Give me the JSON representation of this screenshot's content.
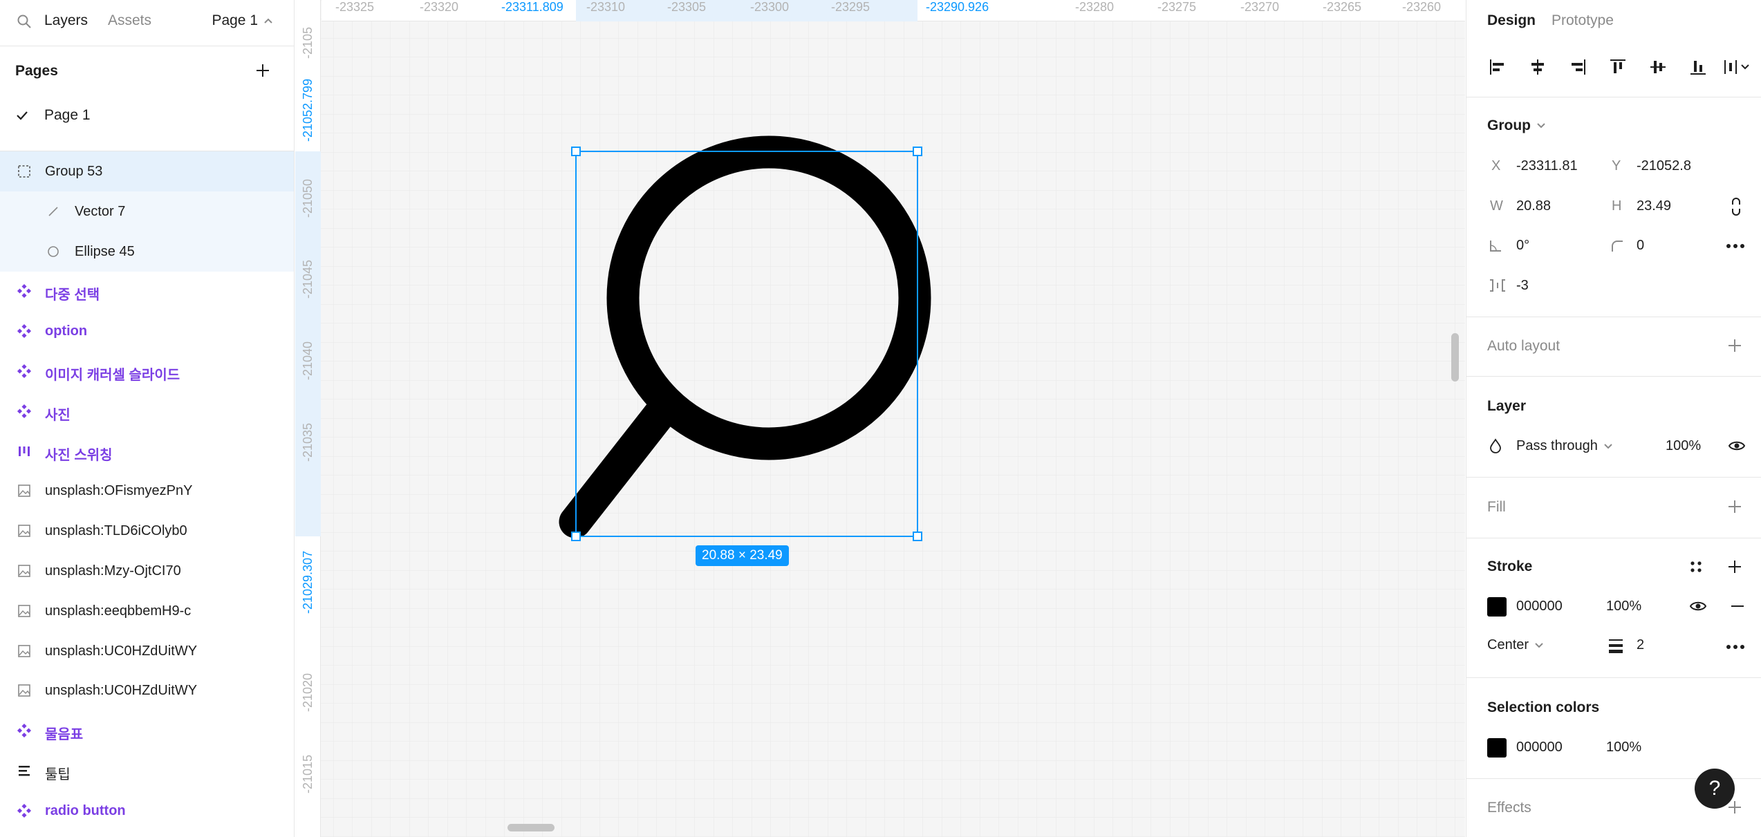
{
  "left_panel": {
    "tabs": {
      "layers": "Layers",
      "assets": "Assets"
    },
    "page_selector": "Page 1",
    "pages_title": "Pages",
    "pages": [
      {
        "label": "Page 1",
        "current": true
      }
    ],
    "layers": [
      {
        "label": "Group 53",
        "icon": "group-dashed-icon",
        "kind": "group",
        "selected": true,
        "indent": 0
      },
      {
        "label": "Vector 7",
        "icon": "vector-line-icon",
        "kind": "vector",
        "selected": false,
        "indent": 1
      },
      {
        "label": "Ellipse 45",
        "icon": "ellipse-icon",
        "kind": "ellipse",
        "selected": false,
        "indent": 1
      },
      {
        "label": "다중 선택",
        "icon": "component-icon",
        "kind": "component",
        "indent": 0
      },
      {
        "label": "option",
        "icon": "component-icon",
        "kind": "component",
        "indent": 0
      },
      {
        "label": "이미지 캐러셀 슬라이드",
        "icon": "component-icon",
        "kind": "component",
        "indent": 0
      },
      {
        "label": "사진",
        "icon": "component-icon",
        "kind": "component",
        "indent": 0
      },
      {
        "label": "사진 스위칭",
        "icon": "auto-layout-icon",
        "kind": "component",
        "indent": 0
      },
      {
        "label": "unsplash:OFismyezPnY",
        "icon": "image-icon",
        "kind": "image",
        "indent": 0
      },
      {
        "label": "unsplash:TLD6iCOlyb0",
        "icon": "image-icon",
        "kind": "image",
        "indent": 0
      },
      {
        "label": "unsplash:Mzy-OjtCI70",
        "icon": "image-icon",
        "kind": "image",
        "indent": 0
      },
      {
        "label": "unsplash:eeqbbemH9-c",
        "icon": "image-icon",
        "kind": "image",
        "indent": 0
      },
      {
        "label": "unsplash:UC0HZdUitWY",
        "icon": "image-icon",
        "kind": "image",
        "indent": 0
      },
      {
        "label": "unsplash:UC0HZdUitWY",
        "icon": "image-icon",
        "kind": "image",
        "indent": 0
      },
      {
        "label": "물음표",
        "icon": "component-icon",
        "kind": "component",
        "indent": 0
      },
      {
        "label": "툴팁",
        "icon": "text-lines-icon",
        "kind": "frame",
        "indent": 0
      },
      {
        "label": "radio button",
        "icon": "component-icon",
        "kind": "component",
        "indent": 0
      }
    ]
  },
  "canvas": {
    "ruler_top": [
      "-23325",
      "-23320",
      "-23311.809",
      "-23310",
      "-23305",
      "-23300",
      "-23295",
      "-23290.926",
      "-23280",
      "-23275",
      "-23270",
      "-23265",
      "-23260"
    ],
    "ruler_top_highlight": [
      "-23311.809",
      "-23290.926"
    ],
    "ruler_left": [
      "-2105",
      "-21052.799",
      "-21050",
      "-21045",
      "-21040",
      "-21035",
      "-21029.307",
      "-21020",
      "-21015"
    ],
    "ruler_left_highlight": [
      "-21052.799",
      "-21029.307"
    ],
    "size_badge": "20.88 × 23.49"
  },
  "right_panel": {
    "tabs": {
      "design": "Design",
      "prototype": "Prototype"
    },
    "selection_type": "Group",
    "position": {
      "x_label": "X",
      "x": "-23311.81",
      "y_label": "Y",
      "y": "-21052.8"
    },
    "size": {
      "w_label": "W",
      "w": "20.88",
      "h_label": "H",
      "h": "23.49"
    },
    "rotation": "0°",
    "radius": "0",
    "spacing": "-3",
    "auto_layout": "Auto layout",
    "layer": {
      "title": "Layer",
      "blend": "Pass through",
      "opacity": "100%"
    },
    "fill": {
      "title": "Fill"
    },
    "stroke": {
      "title": "Stroke",
      "color": "000000",
      "opacity": "100%",
      "position": "Center",
      "weight": "2"
    },
    "selection_colors": {
      "title": "Selection colors",
      "color": "000000",
      "opacity": "100%"
    },
    "effects": {
      "title": "Effects"
    },
    "help": "?"
  },
  "colors": {
    "accent": "#0d99ff",
    "component": "#7b3fe4",
    "selection_bg": "#e5f1fc",
    "canvas_bg": "#f5f5f5"
  }
}
